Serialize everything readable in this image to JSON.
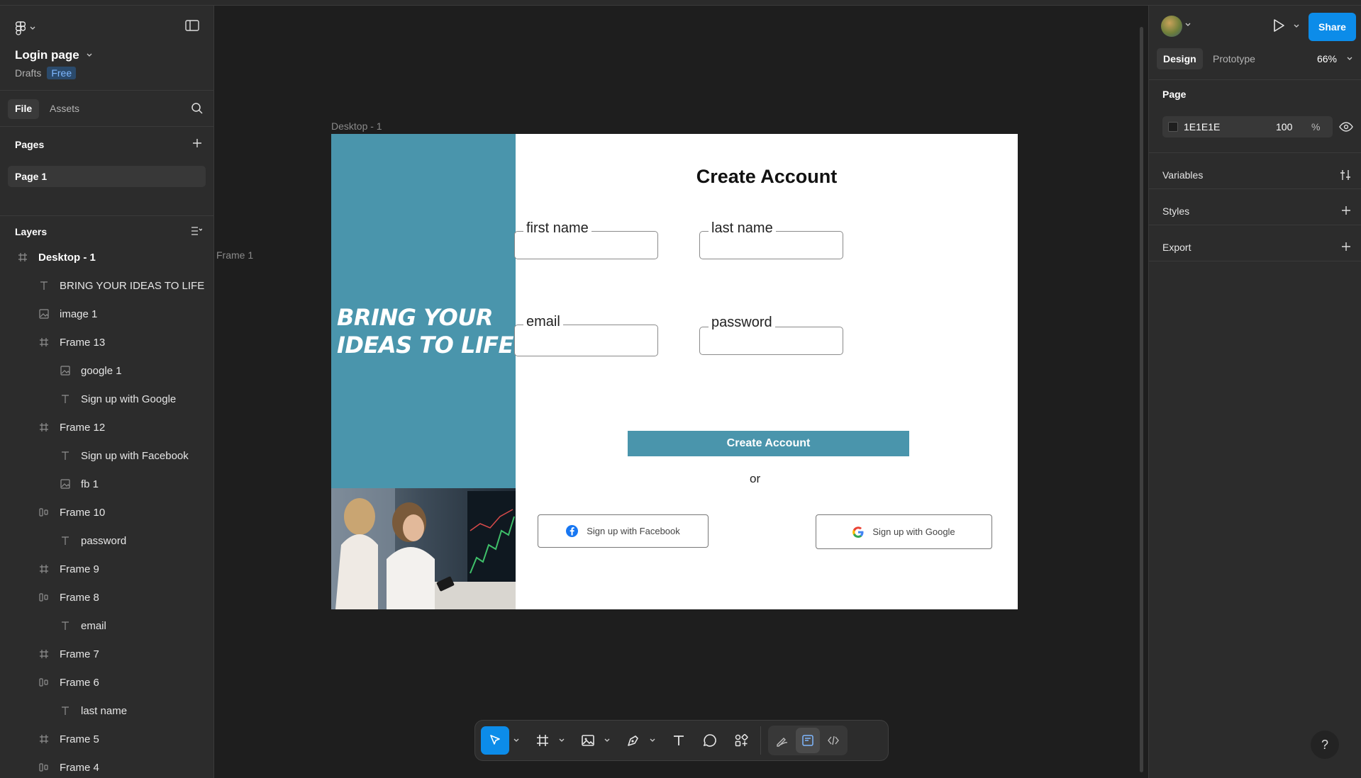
{
  "app": {
    "file_name": "Login page",
    "location": "Drafts",
    "plan_badge": "Free"
  },
  "left_tabs": {
    "file": "File",
    "assets": "Assets"
  },
  "pages": {
    "title": "Pages",
    "items": [
      "Page 1"
    ]
  },
  "layers": {
    "title": "Layers",
    "items": [
      {
        "label": "Desktop - 1",
        "icon": "frame-icon",
        "depth": 0
      },
      {
        "label": "BRING YOUR IDEAS TO LIFE",
        "icon": "text-icon",
        "depth": 1
      },
      {
        "label": "image 1",
        "icon": "image-icon",
        "depth": 1
      },
      {
        "label": "Frame 13",
        "icon": "frame-icon",
        "depth": 1
      },
      {
        "label": "google 1",
        "icon": "image-icon",
        "depth": 2
      },
      {
        "label": "Sign up with Google",
        "icon": "text-icon",
        "depth": 2
      },
      {
        "label": "Frame 12",
        "icon": "frame-icon",
        "depth": 1
      },
      {
        "label": "Sign up with Facebook",
        "icon": "text-icon",
        "depth": 2
      },
      {
        "label": "fb 1",
        "icon": "image-icon",
        "depth": 2
      },
      {
        "label": "Frame 10",
        "icon": "autolayout-icon",
        "depth": 1
      },
      {
        "label": "password",
        "icon": "text-icon",
        "depth": 2
      },
      {
        "label": "Frame 9",
        "icon": "frame-icon",
        "depth": 1
      },
      {
        "label": "Frame 8",
        "icon": "autolayout-icon",
        "depth": 1
      },
      {
        "label": "email",
        "icon": "text-icon",
        "depth": 2
      },
      {
        "label": "Frame 7",
        "icon": "frame-icon",
        "depth": 1
      },
      {
        "label": "Frame 6",
        "icon": "autolayout-icon",
        "depth": 1
      },
      {
        "label": "last name",
        "icon": "text-icon",
        "depth": 2
      },
      {
        "label": "Frame 5",
        "icon": "frame-icon",
        "depth": 1
      },
      {
        "label": "Frame 4",
        "icon": "autolayout-icon",
        "depth": 1
      }
    ]
  },
  "canvas": {
    "frame_label": "Desktop - 1",
    "side_label": "Frame 1",
    "design": {
      "hero_text": "BRING YOUR IDEAS TO LIFE",
      "title": "Create Account",
      "fields": {
        "first_name": "first name",
        "last_name": "last name",
        "email": "email",
        "password": "password"
      },
      "cta": "Create Account",
      "or": "or",
      "facebook_btn": "Sign up with Facebook",
      "google_btn": "Sign up with Google",
      "accent": "#4a95ac"
    }
  },
  "toolbar": {
    "tools": [
      "move-tool",
      "frame-tool",
      "image-tool",
      "pen-tool",
      "text-tool",
      "comment-tool",
      "actions-tool"
    ],
    "modes": [
      "draw-mode",
      "design-mode",
      "dev-mode"
    ]
  },
  "right_panel": {
    "share": "Share",
    "tabs": {
      "design": "Design",
      "prototype": "Prototype"
    },
    "zoom": "66%",
    "page_section": "Page",
    "background_hex": "1E1E1E",
    "background_opacity": "100",
    "percent_sign": "%",
    "variables": "Variables",
    "styles": "Styles",
    "export": "Export",
    "help": "?"
  },
  "colors": {
    "accent_blue": "#0c8ce9",
    "canvas_bg": "#1e1e1e",
    "panel_bg": "#2c2c2c"
  }
}
